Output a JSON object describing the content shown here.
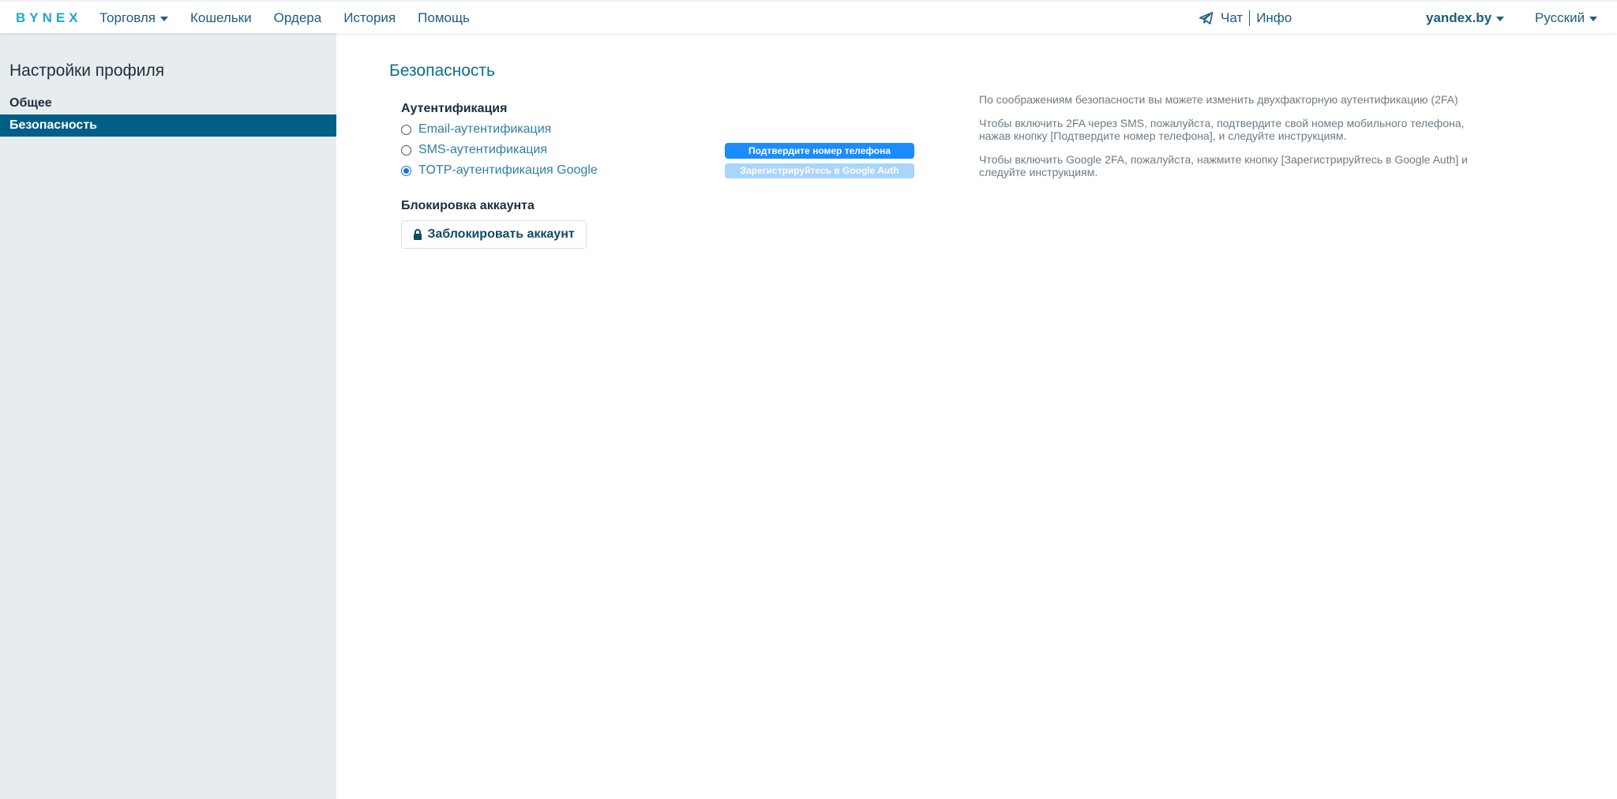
{
  "header": {
    "logo": "BYNEX",
    "nav": [
      {
        "label": "Торговля",
        "has_caret": true
      },
      {
        "label": "Кошельки",
        "has_caret": false
      },
      {
        "label": "Ордера",
        "has_caret": false
      },
      {
        "label": "История",
        "has_caret": false
      },
      {
        "label": "Помощь",
        "has_caret": false
      }
    ],
    "chat_label": "Чат",
    "info_label": "Инфо",
    "user_label": "yandex.by",
    "language_label": "Русский"
  },
  "sidebar": {
    "title": "Настройки профиля",
    "items": [
      {
        "label": "Общее",
        "active": false
      },
      {
        "label": "Безопасность",
        "active": true
      }
    ]
  },
  "main": {
    "section_title": "Безопасность",
    "auth_title": "Аутентификация",
    "auth_options": [
      {
        "label": "Email-аутентификация",
        "checked": false
      },
      {
        "label": "SMS-аутентификация",
        "checked": false
      },
      {
        "label": "TOTP-аутентификация Google",
        "checked": true
      }
    ],
    "confirm_phone_button": "Подтвердите номер телефона",
    "register_google_button": "Зарегистрируйтесь в Google Auth",
    "lock_title": "Блокировка аккаунта",
    "lock_button": "Заблокировать аккаунт",
    "help": [
      "По соображениям безопасности вы можете изменить двухфакторную аутентификацию (2FA)",
      "Чтобы включить 2FA через SMS, пожалуйста, подтвердите свой номер мобильного телефона, нажав кнопку [Подтвердите номер телефона], и следуйте инструкциям.",
      "Чтобы включить Google 2FA, пожалуйста, нажмите кнопку [Зарегистрируйтесь в Google Auth] и следуйте инструкциям."
    ]
  },
  "colors": {
    "accent": "#1a8cff",
    "accent_light": "#a9d4fb",
    "sidebar_active": "#005f86",
    "sidebar_bg": "#e7ecef",
    "logo": "#20a9c9"
  },
  "icons": [
    "telegram-icon",
    "lock-icon",
    "caret-down-icon"
  ]
}
